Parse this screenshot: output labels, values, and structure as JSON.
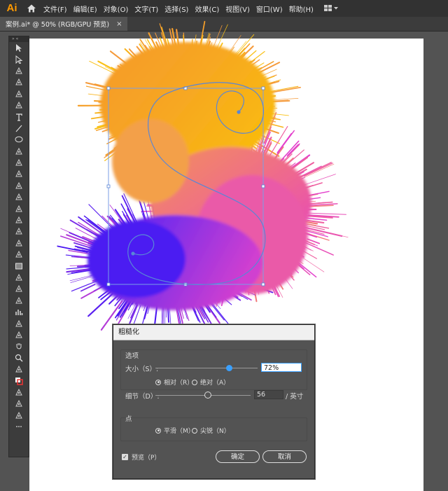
{
  "app": {
    "logo": "Ai"
  },
  "menu": [
    "文件(F)",
    "编辑(E)",
    "对象(O)",
    "文字(T)",
    "选择(S)",
    "效果(C)",
    "视图(V)",
    "窗口(W)",
    "帮助(H)"
  ],
  "document_tab": {
    "title": "案例.ai* @ 50% (RGB/GPU 预览)",
    "close": "×"
  },
  "toolbar": {
    "header": "» «",
    "tools": [
      "selection-tool",
      "direct-selection-tool",
      "magic-wand-tool",
      "lasso-tool",
      "pen-tool",
      "curvature-tool",
      "type-tool",
      "line-tool",
      "ellipse-tool",
      "paintbrush-tool",
      "blob-brush-tool",
      "eraser-tool",
      "rotate-tool",
      "scale-tool",
      "warp-tool",
      "free-transform-tool",
      "shape-builder-tool",
      "perspective-grid-tool",
      "mesh-tool",
      "gradient-tool",
      "eyedropper-tool",
      "blend-tool",
      "symbol-sprayer-tool",
      "column-graph-tool",
      "artboard-tool",
      "slice-tool",
      "hand-tool",
      "zoom-tool",
      "fill-stroke-default",
      "fill-stroke-swatch",
      "color-mode",
      "draw-mode",
      "change-screen-mode",
      "edit-toolbar"
    ]
  },
  "colors": {
    "fur_orange": "#f7b11a",
    "fur_pink": "#f04fa8",
    "fur_purple": "#5a20f0",
    "path_blue": "#5a86d6",
    "accent": "#3aa0ff"
  },
  "dialog": {
    "title": "粗糙化",
    "options_group": "选项",
    "size_label": "大小（S）:",
    "size_value": "72%",
    "size_fraction": 0.72,
    "relative_label": "相对（R）",
    "absolute_label": "绝对（A）",
    "detail_label": "细节（D）:",
    "detail_value": "56",
    "detail_unit": "/ 英寸",
    "points_group": "点",
    "smooth_label": "平滑（M）",
    "corner_label": "尖锐（N）",
    "preview_label": "预览（P）",
    "ok_label": "确定",
    "cancel_label": "取消"
  }
}
